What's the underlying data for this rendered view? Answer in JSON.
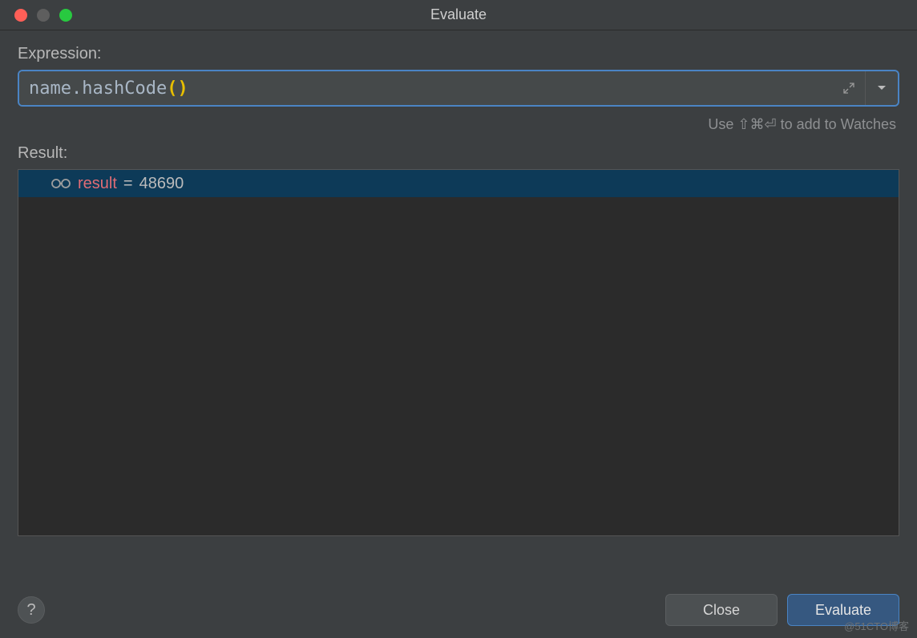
{
  "window": {
    "title": "Evaluate"
  },
  "expression": {
    "label": "Expression:",
    "code_name": "name",
    "code_dot": ".",
    "code_method": "hashCode",
    "code_paren_open": "(",
    "code_paren_close": ")"
  },
  "hint": {
    "text": "Use ⇧⌘⏎ to add to Watches"
  },
  "result": {
    "label": "Result:",
    "var_name": "result",
    "eq": " = ",
    "value": "48690"
  },
  "buttons": {
    "help": "?",
    "close": "Close",
    "evaluate": "Evaluate"
  },
  "watermark": "@51CTO博客"
}
